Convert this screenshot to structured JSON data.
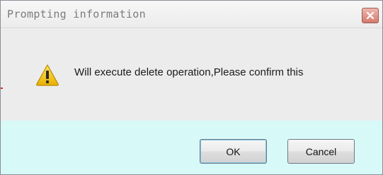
{
  "dialog": {
    "title": "Prompting information",
    "message": "Will execute delete operation,Please confirm this",
    "icons": {
      "close": "close-icon",
      "warning": "warning-icon"
    },
    "buttons": {
      "ok_label": "OK",
      "cancel_label": "Cancel"
    },
    "colors": {
      "button_area_background": "#d7f9f8",
      "close_button": "#d67a6d",
      "warning_yellow": "#f2c200"
    }
  }
}
